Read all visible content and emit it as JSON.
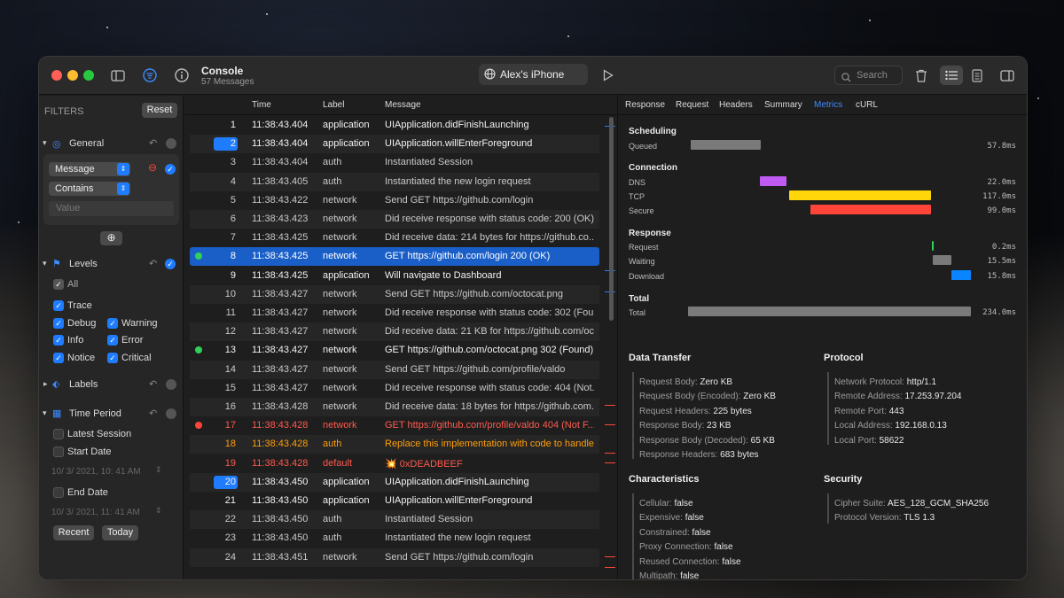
{
  "window": {
    "title": "Console",
    "subtitle": "57 Messages",
    "device": "Alex's iPhone",
    "search_placeholder": "Search"
  },
  "sidebar": {
    "filters_label": "FILTERS",
    "reset_label": "Reset",
    "general_label": "General",
    "field_select": "Message",
    "op_select": "Contains",
    "value_placeholder": "Value",
    "levels_label": "Levels",
    "all_label": "All",
    "levels": [
      {
        "label": "Trace",
        "checked": true
      },
      {
        "label": "Debug",
        "checked": true
      },
      {
        "label": "Warning",
        "checked": true
      },
      {
        "label": "Info",
        "checked": true
      },
      {
        "label": "Error",
        "checked": true
      },
      {
        "label": "Notice",
        "checked": true
      },
      {
        "label": "Critical",
        "checked": true
      }
    ],
    "labels_label": "Labels",
    "time_label": "Time Period",
    "latest_session": "Latest Session",
    "start_date": "Start Date",
    "start_value": "10/  3/ 2021, 10: 41 AM",
    "end_date": "End Date",
    "end_value": "10/  3/ 2021, 11: 41 AM",
    "recent_btn": "Recent",
    "today_btn": "Today"
  },
  "table": {
    "headers": {
      "time": "Time",
      "label": "Label",
      "message": "Message"
    },
    "rows": [
      {
        "idx": "1",
        "time": "11:38:43.404",
        "label": "application",
        "msg": "UIApplication.didFinishLaunching",
        "kind": "bold"
      },
      {
        "idx": "2",
        "time": "11:38:43.404",
        "label": "application",
        "msg": "UIApplication.willEnterForeground",
        "kind": "bold",
        "pin": true
      },
      {
        "idx": "3",
        "time": "11:38:43.404",
        "label": "auth",
        "msg": "Instantiated Session",
        "kind": ""
      },
      {
        "idx": "4",
        "time": "11:38:43.405",
        "label": "auth",
        "msg": "Instantiated the new login request",
        "kind": ""
      },
      {
        "idx": "5",
        "time": "11:38:43.422",
        "label": "network",
        "msg": "Send GET https://github.com/login",
        "kind": ""
      },
      {
        "idx": "6",
        "time": "11:38:43.423",
        "label": "network",
        "msg": "Did receive response with status code: 200 (OK)...",
        "kind": ""
      },
      {
        "idx": "7",
        "time": "11:38:43.425",
        "label": "network",
        "msg": "Did receive data: 214 bytes for https://github.co...",
        "kind": ""
      },
      {
        "idx": "8",
        "time": "11:38:43.425",
        "label": "network",
        "msg": "GET https://github.com/login 200 (OK)",
        "kind": "sel",
        "dot": "#30d158"
      },
      {
        "idx": "9",
        "time": "11:38:43.425",
        "label": "application",
        "msg": "Will navigate to Dashboard",
        "kind": "bold"
      },
      {
        "idx": "10",
        "time": "11:38:43.427",
        "label": "network",
        "msg": "Send GET https://github.com/octocat.png",
        "kind": ""
      },
      {
        "idx": "11",
        "time": "11:38:43.427",
        "label": "network",
        "msg": "Did receive response with status code: 302 (Fou...",
        "kind": ""
      },
      {
        "idx": "12",
        "time": "11:38:43.427",
        "label": "network",
        "msg": "Did receive data: 21 KB for https://github.com/oc...",
        "kind": ""
      },
      {
        "idx": "13",
        "time": "11:38:43.427",
        "label": "network",
        "msg": "GET https://github.com/octocat.png 302 (Found)",
        "kind": "bold",
        "dot": "#30d158"
      },
      {
        "idx": "14",
        "time": "11:38:43.427",
        "label": "network",
        "msg": "Send GET https://github.com/profile/valdo",
        "kind": ""
      },
      {
        "idx": "15",
        "time": "11:38:43.427",
        "label": "network",
        "msg": "Did receive response with status code: 404 (Not...",
        "kind": ""
      },
      {
        "idx": "16",
        "time": "11:38:43.428",
        "label": "network",
        "msg": "Did receive data: 18 bytes for https://github.com...",
        "kind": ""
      },
      {
        "idx": "17",
        "time": "11:38:43.428",
        "label": "network",
        "msg": "GET https://github.com/profile/valdo 404 (Not F...",
        "kind": "err",
        "dot": "#ff453a"
      },
      {
        "idx": "18",
        "time": "11:38:43.428",
        "label": "auth",
        "msg": "Replace this implementation with code to handle...",
        "kind": "warn"
      },
      {
        "idx": "19",
        "time": "11:38:43.428",
        "label": "default",
        "msg": "💥 0xDEADBEEF",
        "kind": "err"
      },
      {
        "idx": "20",
        "time": "11:38:43.450",
        "label": "application",
        "msg": "UIApplication.didFinishLaunching",
        "kind": "bold",
        "pin": true
      },
      {
        "idx": "21",
        "time": "11:38:43.450",
        "label": "application",
        "msg": "UIApplication.willEnterForeground",
        "kind": "bold"
      },
      {
        "idx": "22",
        "time": "11:38:43.450",
        "label": "auth",
        "msg": "Instantiated Session",
        "kind": ""
      },
      {
        "idx": "23",
        "time": "11:38:43.450",
        "label": "auth",
        "msg": "Instantiated the new login request",
        "kind": ""
      },
      {
        "idx": "24",
        "time": "11:38:43.451",
        "label": "network",
        "msg": "Send GET https://github.com/login",
        "kind": ""
      }
    ]
  },
  "detail": {
    "tabs": [
      "Response",
      "Request",
      "Headers",
      "Summary",
      "Metrics",
      "cURL"
    ],
    "active_tab": "Metrics",
    "metrics": {
      "scheduling": "Scheduling",
      "queued": "Queued",
      "queued_val": "57.8ms",
      "connection": "Connection",
      "dns": "DNS",
      "dns_val": "22.0ms",
      "tcp": "TCP",
      "tcp_val": "117.0ms",
      "secure": "Secure",
      "secure_val": "99.0ms",
      "response": "Response",
      "request": "Request",
      "request_val": "0.2ms",
      "waiting": "Waiting",
      "waiting_val": "15.5ms",
      "download": "Download",
      "download_val": "15.8ms",
      "total": "Total",
      "total_lab": "Total",
      "total_val": "234.0ms"
    },
    "data_transfer": {
      "title": "Data Transfer",
      "items": [
        {
          "k": "Request Body:",
          "v": "Zero KB"
        },
        {
          "k": "Request Body (Encoded):",
          "v": "Zero KB"
        },
        {
          "k": "Request Headers:",
          "v": "225 bytes"
        },
        {
          "k": "Response Body:",
          "v": "23 KB"
        },
        {
          "k": "Response Body (Decoded):",
          "v": "65 KB"
        },
        {
          "k": "Response Headers:",
          "v": "683 bytes"
        }
      ]
    },
    "protocol": {
      "title": "Protocol",
      "items": [
        {
          "k": "Network Protocol:",
          "v": "http/1.1"
        },
        {
          "k": "Remote Address:",
          "v": "17.253.97.204"
        },
        {
          "k": "Remote Port:",
          "v": "443"
        },
        {
          "k": "Local Address:",
          "v": "192.168.0.13"
        },
        {
          "k": "Local Port:",
          "v": "58622"
        }
      ]
    },
    "characteristics": {
      "title": "Characteristics",
      "items": [
        {
          "k": "Cellular:",
          "v": "false"
        },
        {
          "k": "Expensive:",
          "v": "false"
        },
        {
          "k": "Constrained:",
          "v": "false"
        },
        {
          "k": "Proxy Connection:",
          "v": "false"
        },
        {
          "k": "Reused Connection:",
          "v": "false"
        },
        {
          "k": "Multipath:",
          "v": "false"
        }
      ]
    },
    "security": {
      "title": "Security",
      "items": [
        {
          "k": "Cipher Suite:",
          "v": "AES_128_GCM_SHA256"
        },
        {
          "k": "Protocol Version:",
          "v": "TLS 1.3"
        }
      ]
    }
  },
  "colors": {
    "accent": "#1f7cff",
    "dns": "#bf5af2",
    "tcp": "#ffd60a",
    "secure": "#ff453a",
    "download": "#0a84ff",
    "queued": "#7a7a7a"
  }
}
